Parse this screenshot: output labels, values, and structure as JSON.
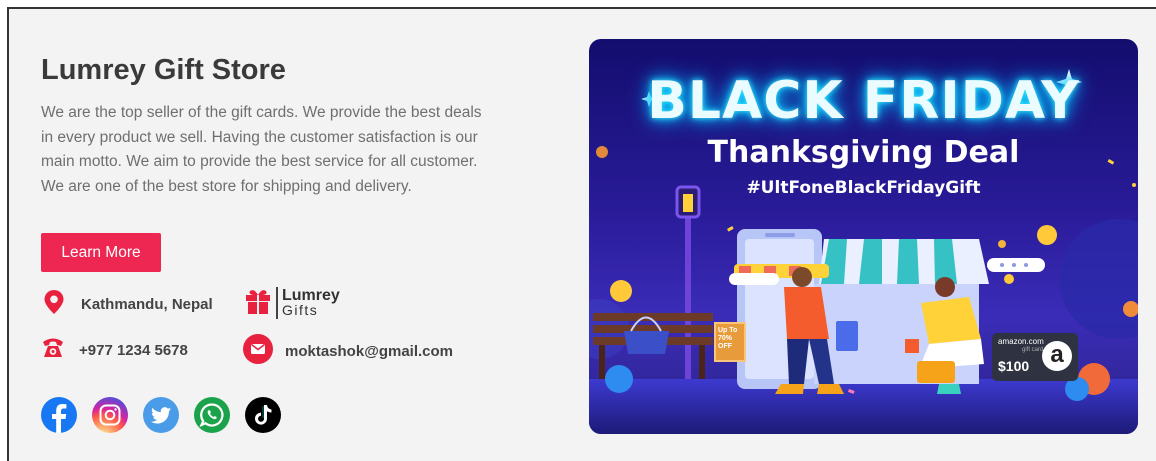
{
  "store": {
    "title": "Lumrey Gift Store",
    "description": "We are the top seller of the gift cards. We provide the best deals in every product we sell. Having the customer satisfaction is our main motto. We aim to provide the best service for all customer. We are one of the best store for shipping and delivery.",
    "button_label": "Learn More"
  },
  "contact": {
    "location": "Kathmandu, Nepal",
    "phone": "+977 1234 5678",
    "email": "moktashok@gmail.com"
  },
  "logo": {
    "line1": "Lumrey",
    "line2": "Gifts"
  },
  "socials": [
    {
      "name": "facebook-icon",
      "color": "#1877f2"
    },
    {
      "name": "instagram-icon",
      "color": "#d6249f"
    },
    {
      "name": "twitter-icon",
      "color": "#4a9ce8"
    },
    {
      "name": "whatsapp-icon",
      "color": "#25d366"
    },
    {
      "name": "tiktok-icon",
      "color": "#000000"
    }
  ],
  "banner": {
    "title": "BLACK FRIDAY",
    "subtitle": "Thanksgiving Deal",
    "hashtag": "#UltFoneBlackFridayGift",
    "sign_line1": "Up To",
    "sign_line2": "70%",
    "sign_line3": "OFF",
    "giftcard_brand": "amazon.com",
    "giftcard_label": "gift card",
    "giftcard_value": "$100",
    "giftcard_letter": "a"
  },
  "colors": {
    "accent": "#ee2652",
    "banner_bg": "#2a1c9a"
  }
}
